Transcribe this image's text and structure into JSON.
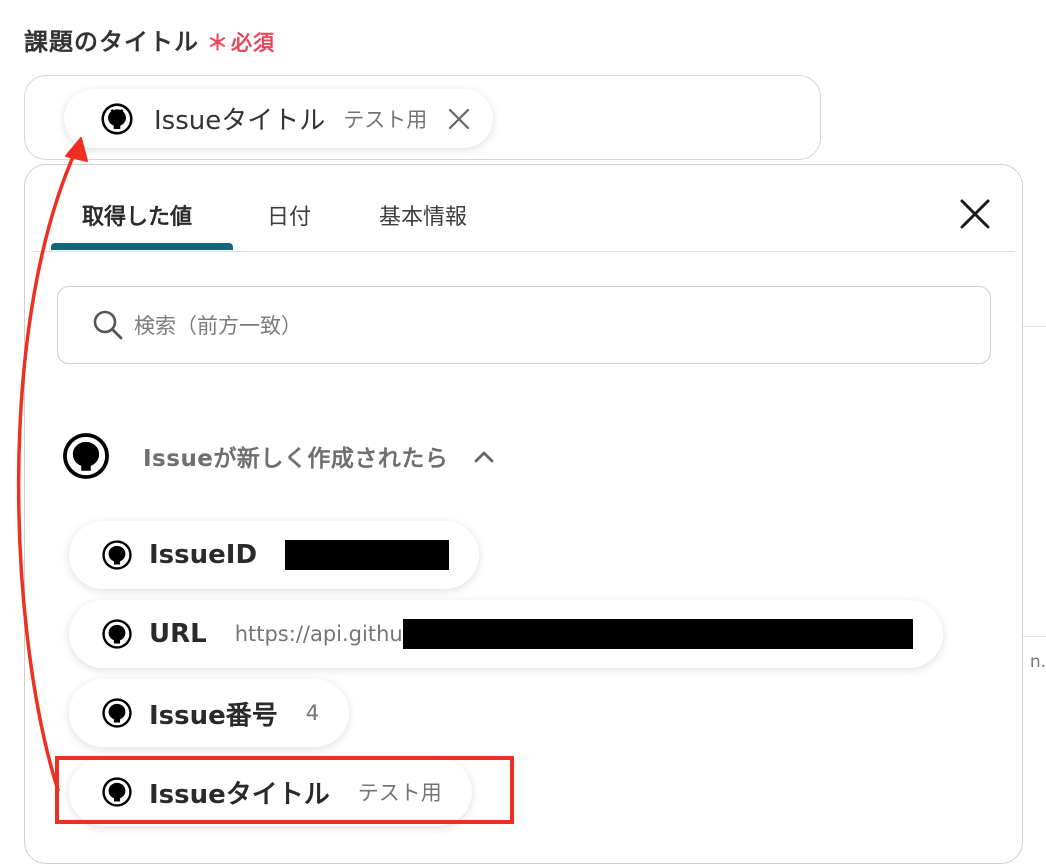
{
  "field": {
    "label": "課題のタイトル",
    "required_mark": "＊",
    "required_label": "必須",
    "selected_chip": {
      "label": "Issueタイトル",
      "value": "テスト用"
    }
  },
  "panel": {
    "tabs": [
      {
        "label": "取得した値",
        "active": true
      },
      {
        "label": "日付",
        "active": false
      },
      {
        "label": "基本情報",
        "active": false
      }
    ],
    "search": {
      "placeholder": "検索（前方一致）"
    },
    "group": {
      "title": "Issueが新しく作成されたら",
      "expanded": true,
      "items": [
        {
          "label": "IssueID",
          "value": "",
          "redacted": true
        },
        {
          "label": "URL",
          "value": "https://api.githu",
          "redacted": true
        },
        {
          "label": "Issue番号",
          "value": "4",
          "redacted": false
        },
        {
          "label": "Issueタイトル",
          "value": "テスト用",
          "redacted": false,
          "highlighted": true
        }
      ]
    }
  },
  "edge_partial_text": "n.",
  "colors": {
    "accent_tab": "#14667a",
    "required": "#e8485b",
    "annotation": "#ee2f22"
  },
  "icons": [
    "github-icon",
    "search-icon",
    "close-icon",
    "chevron-up-icon"
  ]
}
